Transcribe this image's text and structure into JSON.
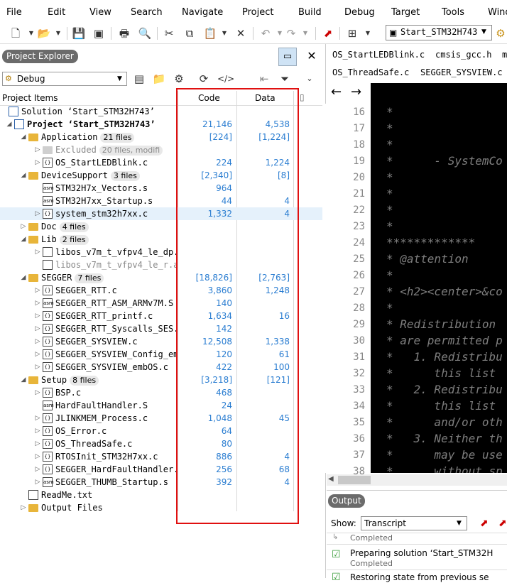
{
  "menu": [
    "File",
    "Edit",
    "View",
    "Search",
    "Navigate",
    "Project",
    "Build",
    "Debug",
    "Target",
    "Tools",
    "Wind"
  ],
  "toolbar": {
    "project_select": "Start_STM32H743"
  },
  "explorer": {
    "title": "Project Explorer",
    "config": "Debug",
    "headers": {
      "items": "Project Items",
      "code": "Code",
      "data": "Data"
    }
  },
  "tree": [
    {
      "label": "Solution ‘Start_STM32H743’",
      "code": "",
      "data": "",
      "icon": "solution",
      "indent": 0,
      "twisty": ""
    },
    {
      "label": "Project ‘Start_STM32H743’",
      "code": "21,146",
      "data": "4,538",
      "icon": "project",
      "indent": 1,
      "twisty": "◢",
      "bold": true
    },
    {
      "label": "Application",
      "badge": "21 files",
      "code": "[224]",
      "data": "[1,224]",
      "icon": "folder",
      "indent": 2,
      "twisty": "◢"
    },
    {
      "label": "Excluded",
      "badge": "20 files, modifi",
      "code": "",
      "data": "",
      "icon": "folder-gray",
      "indent": 3,
      "twisty": "▷",
      "gray": true
    },
    {
      "label": "OS_StartLEDBlink.c",
      "code": "224",
      "data": "1,224",
      "icon": "c",
      "indent": 3,
      "twisty": "▷"
    },
    {
      "label": "DeviceSupport",
      "badge": "3 files",
      "code": "[2,340]",
      "data": "[8]",
      "icon": "folder",
      "indent": 2,
      "twisty": "◢"
    },
    {
      "label": "STM32H7x_Vectors.s",
      "code": "964",
      "data": "",
      "icon": "asm",
      "indent": 3,
      "twisty": ""
    },
    {
      "label": "STM32H7xx_Startup.s",
      "code": "44",
      "data": "4",
      "icon": "asm",
      "indent": 3,
      "twisty": ""
    },
    {
      "label": "system_stm32h7xx.c",
      "code": "1,332",
      "data": "4",
      "icon": "c",
      "indent": 3,
      "twisty": "▷",
      "sel": true
    },
    {
      "label": "Doc",
      "badge": "4 files",
      "code": "",
      "data": "",
      "icon": "folder",
      "indent": 2,
      "twisty": "▷"
    },
    {
      "label": "Lib",
      "badge": "2 files",
      "code": "",
      "data": "",
      "icon": "folder",
      "indent": 2,
      "twisty": "◢"
    },
    {
      "label": "libos_v7m_t_vfpv4_le_dp.",
      "code": "",
      "data": "",
      "icon": "lib",
      "indent": 3,
      "twisty": "▷"
    },
    {
      "label": "libos_v7m_t_vfpv4_le_r.a",
      "code": "",
      "data": "",
      "icon": "lib",
      "indent": 3,
      "twisty": "",
      "gray": true
    },
    {
      "label": "SEGGER",
      "badge": "7 files",
      "code": "[18,826]",
      "data": "[2,763]",
      "icon": "folder",
      "indent": 2,
      "twisty": "◢"
    },
    {
      "label": "SEGGER_RTT.c",
      "code": "3,860",
      "data": "1,248",
      "icon": "c",
      "indent": 3,
      "twisty": "▷"
    },
    {
      "label": "SEGGER_RTT_ASM_ARMv7M.S",
      "code": "140",
      "data": "",
      "icon": "asm",
      "indent": 3,
      "twisty": "▷"
    },
    {
      "label": "SEGGER_RTT_printf.c",
      "code": "1,634",
      "data": "16",
      "icon": "c",
      "indent": 3,
      "twisty": "▷"
    },
    {
      "label": "SEGGER_RTT_Syscalls_SES.",
      "code": "142",
      "data": "",
      "icon": "c",
      "indent": 3,
      "twisty": "▷"
    },
    {
      "label": "SEGGER_SYSVIEW.c",
      "code": "12,508",
      "data": "1,338",
      "icon": "c",
      "indent": 3,
      "twisty": "▷"
    },
    {
      "label": "SEGGER_SYSVIEW_Config_em",
      "code": "120",
      "data": "61",
      "icon": "c",
      "indent": 3,
      "twisty": "▷"
    },
    {
      "label": "SEGGER_SYSVIEW_embOS.c",
      "code": "422",
      "data": "100",
      "icon": "c",
      "indent": 3,
      "twisty": "▷"
    },
    {
      "label": "Setup",
      "badge": "8 files",
      "code": "[3,218]",
      "data": "[121]",
      "icon": "folder",
      "indent": 2,
      "twisty": "◢"
    },
    {
      "label": "BSP.c",
      "code": "468",
      "data": "",
      "icon": "c",
      "indent": 3,
      "twisty": "▷"
    },
    {
      "label": "HardFaultHandler.S",
      "code": "24",
      "data": "",
      "icon": "asm",
      "indent": 3,
      "twisty": ""
    },
    {
      "label": "JLINKMEM_Process.c",
      "code": "1,048",
      "data": "45",
      "icon": "c",
      "indent": 3,
      "twisty": "▷"
    },
    {
      "label": "OS_Error.c",
      "code": "64",
      "data": "",
      "icon": "c",
      "indent": 3,
      "twisty": "▷"
    },
    {
      "label": "OS_ThreadSafe.c",
      "code": "80",
      "data": "",
      "icon": "c",
      "indent": 3,
      "twisty": "▷"
    },
    {
      "label": "RTOSInit_STM32H7xx.c",
      "code": "886",
      "data": "4",
      "icon": "c",
      "indent": 3,
      "twisty": "▷"
    },
    {
      "label": "SEGGER_HardFaultHandler.",
      "code": "256",
      "data": "68",
      "icon": "c",
      "indent": 3,
      "twisty": "▷"
    },
    {
      "label": "SEGGER_THUMB_Startup.s",
      "code": "392",
      "data": "4",
      "icon": "asm",
      "indent": 3,
      "twisty": "▷"
    },
    {
      "label": "ReadMe.txt",
      "code": "",
      "data": "",
      "icon": "txt",
      "indent": 2,
      "twisty": ""
    },
    {
      "label": "Output Files",
      "code": "",
      "data": "",
      "icon": "folder",
      "indent": 2,
      "twisty": "▷"
    }
  ],
  "editor": {
    "tabs_row1": [
      "OS_StartLEDBlink.c",
      "cmsis_gcc.h",
      "m"
    ],
    "tabs_row2": [
      "OS_ThreadSafe.c",
      "SEGGER_SYSVIEW.c"
    ],
    "lines": [
      {
        "n": "16",
        "t": "*"
      },
      {
        "n": "17",
        "t": "*"
      },
      {
        "n": "18",
        "t": "*"
      },
      {
        "n": "19",
        "t": "*      - SystemCo"
      },
      {
        "n": "20",
        "t": "*"
      },
      {
        "n": "21",
        "t": "*"
      },
      {
        "n": "22",
        "t": "*"
      },
      {
        "n": "23",
        "t": "*"
      },
      {
        "n": "24",
        "t": "*************"
      },
      {
        "n": "25",
        "t": "* @attention"
      },
      {
        "n": "26",
        "t": "*"
      },
      {
        "n": "27",
        "t": "* <h2><center>&co"
      },
      {
        "n": "28",
        "t": "*"
      },
      {
        "n": "29",
        "t": "* Redistribution"
      },
      {
        "n": "30",
        "t": "* are permitted p"
      },
      {
        "n": "31",
        "t": "*   1. Redistribu"
      },
      {
        "n": "32",
        "t": "*      this list"
      },
      {
        "n": "33",
        "t": "*   2. Redistribu"
      },
      {
        "n": "34",
        "t": "*      this list"
      },
      {
        "n": "35",
        "t": "*      and/or oth"
      },
      {
        "n": "36",
        "t": "*   3. Neither th"
      },
      {
        "n": "37",
        "t": "*      may be use"
      },
      {
        "n": "38",
        "t": "*      without sp"
      }
    ]
  },
  "output": {
    "title": "Output",
    "show_label": "Show:",
    "show_value": "Transcript",
    "entries": [
      {
        "title": "",
        "status": "Completed"
      },
      {
        "title": "Preparing solution ‘Start_STM32H",
        "status": "Completed"
      },
      {
        "title": "Restoring state from previous se",
        "status": ""
      }
    ]
  }
}
